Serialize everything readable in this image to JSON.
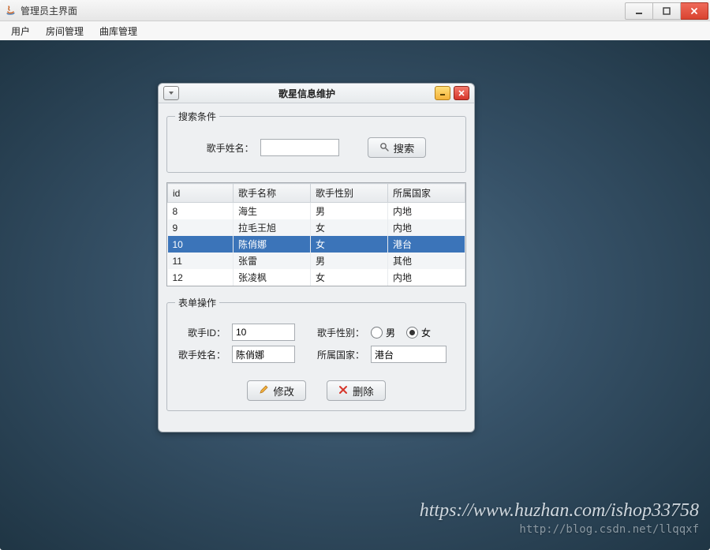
{
  "window": {
    "title": "管理员主界面",
    "controls": {
      "minimize": "minimize",
      "maximize": "maximize",
      "close": "close"
    }
  },
  "menubar": {
    "items": [
      {
        "label": "用户"
      },
      {
        "label": "房间管理"
      },
      {
        "label": "曲库管理"
      }
    ]
  },
  "dialog": {
    "title": "歌星信息维护",
    "search_group": "搜索条件",
    "search_label": "歌手姓名：",
    "search_value": "",
    "search_button": "搜索",
    "form_group": "表单操作",
    "columns": [
      "id",
      "歌手名称",
      "歌手性别",
      "所属国家"
    ],
    "rows": [
      {
        "id": "8",
        "name": "海生",
        "sex": "男",
        "country": "内地",
        "selected": false
      },
      {
        "id": "9",
        "name": "拉毛王旭",
        "sex": "女",
        "country": "内地",
        "selected": false
      },
      {
        "id": "10",
        "name": "陈俏娜",
        "sex": "女",
        "country": "港台",
        "selected": true
      },
      {
        "id": "11",
        "name": "张雷",
        "sex": "男",
        "country": "其他",
        "selected": false
      },
      {
        "id": "12",
        "name": "张凌枫",
        "sex": "女",
        "country": "内地",
        "selected": false
      }
    ],
    "form": {
      "id_label": "歌手ID：",
      "id_value": "10",
      "sex_label": "歌手性别：",
      "sex_male": "男",
      "sex_female": "女",
      "sex_value": "女",
      "name_label": "歌手姓名：",
      "name_value": "陈俏娜",
      "country_label": "所属国家：",
      "country_value": "港台"
    },
    "buttons": {
      "modify": "修改",
      "delete": "删除"
    }
  },
  "watermark": {
    "line1": "https://www.huzhan.com/ishop33758",
    "line2": "http://blog.csdn.net/llqqxf"
  }
}
